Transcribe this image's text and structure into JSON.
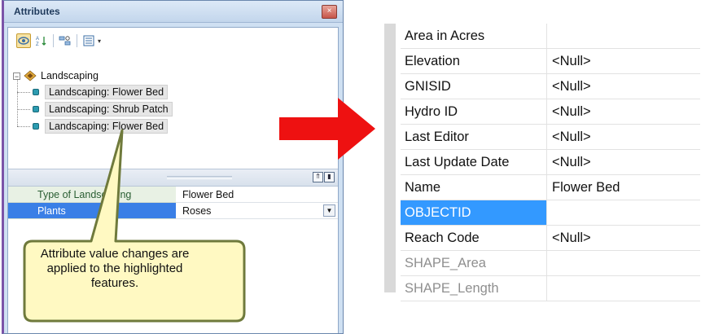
{
  "window": {
    "title": "Attributes",
    "close_glyph": "×"
  },
  "toolbar": {
    "buttons": [
      {
        "icon": "show-features-icon",
        "active": true
      },
      {
        "icon": "sort-ascending-icon",
        "active": false
      },
      {
        "icon": "identify-icon",
        "active": false
      },
      {
        "icon": "options-menu-icon",
        "active": false
      }
    ],
    "dropdown_glyph": "▾"
  },
  "tree": {
    "collapse_glyph": "−",
    "layer": "Landscaping",
    "features": [
      "Landscaping: Flower Bed",
      "Landscaping: Shrub Patch",
      "Landscaping: Flower Bed"
    ]
  },
  "splitter": {
    "btn1": "⇑",
    "btn2": "▮"
  },
  "property_grid": {
    "rows": [
      {
        "key": "Type of Landscaping",
        "value": "Flower Bed",
        "selected": false
      },
      {
        "key": "Plants",
        "value": "Roses",
        "selected": true
      }
    ],
    "dropdown_glyph": "▼"
  },
  "callout": {
    "text": "Attribute value changes are applied to the highlighted features."
  },
  "colors": {
    "arrow": "#ee1111",
    "callout_fill": "#fff9c2",
    "callout_stroke": "#6f7a3c",
    "selection_blue": "#3399ff"
  },
  "table": {
    "rows": [
      {
        "key": "Area in Acres",
        "value": "",
        "state": "normal"
      },
      {
        "key": "Elevation",
        "value": "<Null>",
        "state": "normal"
      },
      {
        "key": "GNISID",
        "value": "<Null>",
        "state": "normal"
      },
      {
        "key": "Hydro ID",
        "value": "<Null>",
        "state": "normal"
      },
      {
        "key": "Last Editor",
        "value": "<Null>",
        "state": "normal"
      },
      {
        "key": "Last Update Date",
        "value": "<Null>",
        "state": "normal"
      },
      {
        "key": "Name",
        "value": "Flower Bed",
        "state": "normal"
      },
      {
        "key": "OBJECTID",
        "value": "",
        "state": "selected"
      },
      {
        "key": "Reach Code",
        "value": "<Null>",
        "state": "normal"
      },
      {
        "key": "SHAPE_Area",
        "value": "",
        "state": "disabled"
      },
      {
        "key": "SHAPE_Length",
        "value": "",
        "state": "disabled"
      }
    ]
  }
}
